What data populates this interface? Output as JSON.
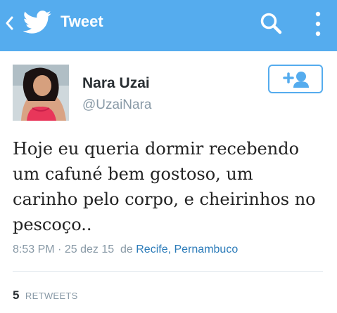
{
  "header": {
    "title": "Tweet",
    "back_icon": "chevron-left-icon",
    "logo_icon": "twitter-bird-icon",
    "search_icon": "search-icon",
    "menu_icon": "more-vertical-icon",
    "background_color": "#55acee"
  },
  "tweet": {
    "author_name": "Nara Uzai",
    "author_handle": "@UzaiNara",
    "follow_icon": "follow-user-icon",
    "text_lines": [
      "Hoje eu queria dormir recebendo",
      "um cafuné bem gostoso, um",
      "carinho pelo corpo, e cheirinhos no",
      "pescoço.."
    ],
    "time": "8:53 PM",
    "separator": "·",
    "date": "25 dez 15",
    "location_prefix": "de",
    "location": "Recife, Pernambuco",
    "retweet_count": "5",
    "retweet_label": "RETWEETS"
  },
  "colors": {
    "accent": "#55acee",
    "link": "#2b7bb9",
    "muted": "#8899a6",
    "text": "#222222"
  }
}
